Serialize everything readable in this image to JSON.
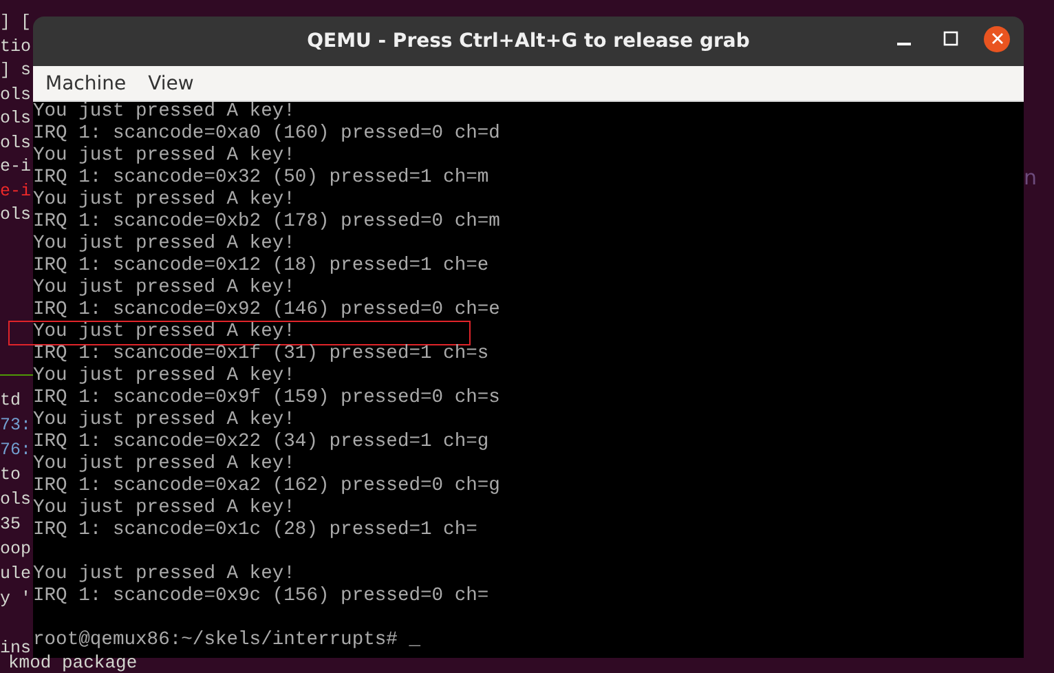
{
  "desktop": {
    "left_top": [
      {
        "text": "] [",
        "color": "#d3d7cf"
      },
      {
        "text": "tio",
        "color": "#d3d7cf"
      },
      {
        "text": "] s",
        "color": "#d3d7cf"
      },
      {
        "text": "ols",
        "color": "#d3d7cf"
      },
      {
        "text": "ols",
        "color": "#d3d7cf"
      },
      {
        "text": "ols",
        "color": "#d3d7cf"
      },
      {
        "text": "e-i",
        "color": "#d3d7cf"
      },
      {
        "text": "e-i",
        "color": "#ef2929"
      },
      {
        "text": "ols",
        "color": "#d3d7cf"
      }
    ],
    "left_bottom": [
      {
        "text": "td",
        "color": "#d3d7cf"
      },
      {
        "text": "73:",
        "color": "#729fcf"
      },
      {
        "text": "76:",
        "color": "#729fcf"
      },
      {
        "text": "to",
        "color": "#d3d7cf"
      },
      {
        "text": "ols",
        "color": "#d3d7cf"
      },
      {
        "text": "35",
        "color": "#d3d7cf"
      },
      {
        "text": "oop",
        "color": "#d3d7cf"
      },
      {
        "text": "ule",
        "color": "#d3d7cf"
      },
      {
        "text": "y '",
        "color": "#d3d7cf"
      }
    ],
    "left_last": "ins",
    "right_fragment": "n",
    "bottom_line": "kmod package"
  },
  "window": {
    "title": "QEMU - Press Ctrl+Alt+G to release grab",
    "menu": [
      "Machine",
      "View"
    ]
  },
  "console": {
    "blocks": [
      [
        {
          "text": "You just pressed A key!",
          "highlighted": false
        },
        {
          "text": "IRQ 1: scancode=0xa0 (160) pressed=0 ch=d",
          "highlighted": false
        },
        {
          "text": "You just pressed A key!",
          "highlighted": false
        },
        {
          "text": "IRQ 1: scancode=0x32 (50) pressed=1 ch=m",
          "highlighted": false
        },
        {
          "text": "You just pressed A key!",
          "highlighted": false
        },
        {
          "text": "IRQ 1: scancode=0xb2 (178) pressed=0 ch=m",
          "highlighted": false
        },
        {
          "text": "You just pressed A key!",
          "highlighted": false
        },
        {
          "text": "IRQ 1: scancode=0x12 (18) pressed=1 ch=e",
          "highlighted": false
        },
        {
          "text": "You just pressed A key!",
          "highlighted": false
        },
        {
          "text": "IRQ 1: scancode=0x92 (146) pressed=0 ch=e",
          "highlighted": false
        },
        {
          "text": "You just pressed A key!",
          "highlighted": true
        },
        {
          "text": "IRQ 1: scancode=0x1f (31) pressed=1 ch=s",
          "highlighted": false
        },
        {
          "text": "You just pressed A key!",
          "highlighted": false
        },
        {
          "text": "IRQ 1: scancode=0x9f (159) pressed=0 ch=s",
          "highlighted": false
        },
        {
          "text": "You just pressed A key!",
          "highlighted": false
        },
        {
          "text": "IRQ 1: scancode=0x22 (34) pressed=1 ch=g",
          "highlighted": false
        },
        {
          "text": "You just pressed A key!",
          "highlighted": false
        },
        {
          "text": "IRQ 1: scancode=0xa2 (162) pressed=0 ch=g",
          "highlighted": false
        },
        {
          "text": "You just pressed A key!",
          "highlighted": false
        },
        {
          "text": "IRQ 1: scancode=0x1c (28) pressed=1 ch=",
          "highlighted": false
        }
      ],
      [
        {
          "text": "You just pressed A key!",
          "highlighted": false
        },
        {
          "text": "IRQ 1: scancode=0x9c (156) pressed=0 ch=",
          "highlighted": false
        }
      ],
      [
        {
          "text": "root@qemux86:~/skels/interrupts# _",
          "highlighted": false
        }
      ]
    ]
  }
}
